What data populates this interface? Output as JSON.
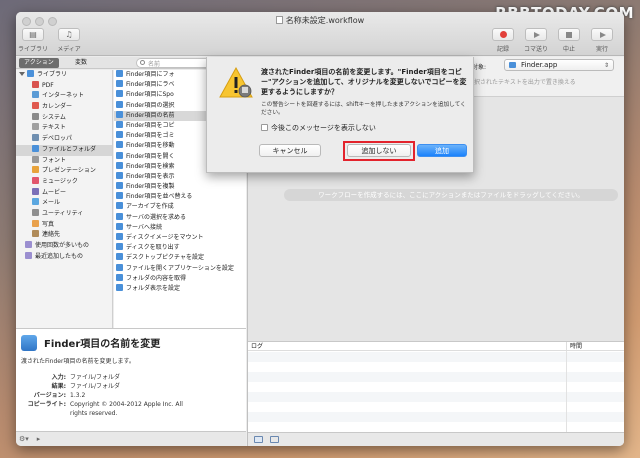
{
  "watermark": "RBBTODAY.COM",
  "window": {
    "title": "名称未設定.workflow"
  },
  "toolbar": {
    "library_label": "ライブラリ",
    "media_label": "メディア",
    "record_label": "記録",
    "step_label": "コマ送り",
    "stop_label": "中止",
    "run_label": "実行"
  },
  "library": {
    "tab_actions": "アクション",
    "tab_variables": "変数",
    "search_placeholder": "名前",
    "categories": [
      {
        "label": "ライブラリ",
        "color": "#4a90d9"
      },
      {
        "label": "PDF",
        "color": "#d9534f"
      },
      {
        "label": "インターネット",
        "color": "#5b9bd5"
      },
      {
        "label": "カレンダー",
        "color": "#e05a4f"
      },
      {
        "label": "システム",
        "color": "#8a8a8a"
      },
      {
        "label": "テキスト",
        "color": "#a0a0a0"
      },
      {
        "label": "デベロッパ",
        "color": "#6f8fb0"
      },
      {
        "label": "ファイルとフォルダ",
        "color": "#4a90d9"
      },
      {
        "label": "フォント",
        "color": "#999999"
      },
      {
        "label": "プレゼンテーション",
        "color": "#e8a33b"
      },
      {
        "label": "ミュージック",
        "color": "#e2566c"
      },
      {
        "label": "ムービー",
        "color": "#7a6fb8"
      },
      {
        "label": "メール",
        "color": "#5ba7e0"
      },
      {
        "label": "ユーティリティ",
        "color": "#8f8f8f"
      },
      {
        "label": "写真",
        "color": "#e9a14c"
      },
      {
        "label": "連絡先",
        "color": "#b08b5a"
      },
      {
        "label": "使用回数が多いもの",
        "color": "#9b8fd0"
      },
      {
        "label": "最近追加したもの",
        "color": "#9b8fd0"
      }
    ],
    "actions": [
      "Finder項目にフォ",
      "Finder項目にラベ",
      "Finder項目にSpo",
      "Finder項目の選択",
      "Finder項目の名前",
      "Finder項目をコピ",
      "Finder項目をゴミ",
      "Finder項目を移動",
      "Finder項目を開く",
      "Finder項目を検索",
      "Finder項目を表示",
      "Finder項目を複製",
      "Finder項目を並べ替える",
      "アーカイブを作成",
      "サーバの選択を求める",
      "サーバへ接続",
      "ディスクイメージをマウント",
      "ディスクを取り出す",
      "デスクトップピクチャを設定",
      "ファイルを開くアプリケーションを設定",
      "フォルダの内容を取得",
      "フォルダ表示を設定"
    ]
  },
  "description": {
    "title": "Finder項目の名前を変更",
    "summary": "渡されたFinder項目の名前を変更します。",
    "input_key": "入力:",
    "input_value": "ファイル/フォルダ",
    "result_key": "結果:",
    "result_value": "ファイル/フォルダ",
    "version_key": "バージョン:",
    "version_value": "1.3.2",
    "copyright_key": "コピーライト:",
    "copyright_value_1": "Copyright © 2004-2012 Apple Inc.  All",
    "copyright_value_2": "rights reserved."
  },
  "workflow": {
    "search_target_label": "検索対象:",
    "search_target_value": "Finder.app",
    "option_label": "選択されたテキストを出力で置き換える",
    "drop_hint": "ワークフローを作成するには、ここにアクションまたはファイルをドラッグしてください。"
  },
  "log": {
    "col_log": "ログ",
    "col_time": "時間"
  },
  "sheet": {
    "title": "渡されたFinder項目の名前を変更します。\"Finder項目をコピー\"アクションを追加して、オリジナルを変更しないでコピーを変更するようにしますか？",
    "info": "この警告シートを回避するには、shiftキーを押したままアクションを追加してください。",
    "checkbox_label": "今後このメッセージを表示しない",
    "cancel_label": "キャンセル",
    "dont_add_label": "追加しない",
    "add_label": "追加",
    "accent_color": "#1a82fb",
    "highlight_color": "#e3232c"
  }
}
